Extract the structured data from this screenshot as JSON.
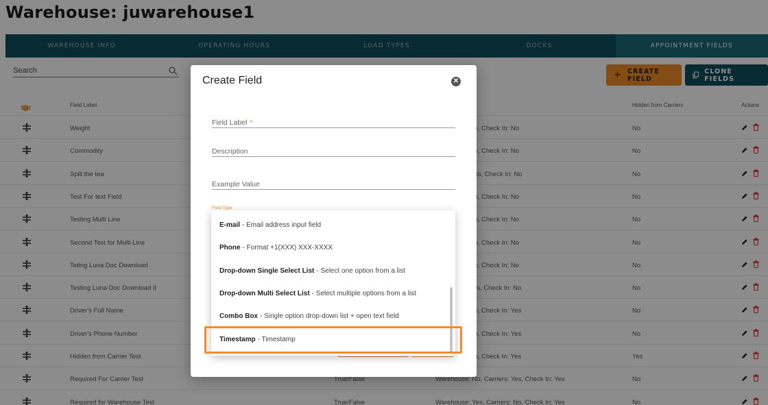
{
  "page": {
    "title": "Warehouse: juwarehouse1"
  },
  "tabs": [
    {
      "label": "WAREHOUSE INFO",
      "active": false
    },
    {
      "label": "OPERATING HOURS",
      "active": false
    },
    {
      "label": "LOAD TYPES",
      "active": false
    },
    {
      "label": "DOCKS",
      "active": false
    },
    {
      "label": "APPOINTMENT FIELDS",
      "active": true
    }
  ],
  "search": {
    "label": "Search"
  },
  "toolbar": {
    "create_label": "CREATE FIELD",
    "create_icon": "+",
    "clone_label": "CLONE FIELDS"
  },
  "table": {
    "headers": {
      "sort": "Sort",
      "field_label": "Field Label",
      "hidden": "Hidden from Carriers",
      "actions": "Actions"
    },
    "rows": [
      {
        "label": "Weight",
        "ftype": "",
        "req": "o, Carriers: No, Check In: No",
        "hidden": "No"
      },
      {
        "label": "Commodity",
        "ftype": "",
        "req": "o, Carriers: No, Check In: No",
        "hidden": "No"
      },
      {
        "label": "Spill the tea",
        "ftype": "",
        "req": "es, Carriers: No, Check In: No",
        "hidden": "No"
      },
      {
        "label": "Test For text Field",
        "ftype": "",
        "req": "o, Carriers: No, Check In: No",
        "hidden": "No"
      },
      {
        "label": "Testing Multi Line",
        "ftype": "",
        "req": "o, Carriers: No, Check In: No",
        "hidden": "No"
      },
      {
        "label": "Second Test for Multi Line",
        "ftype": "",
        "req": "o, Carriers: No, Check In: No",
        "hidden": "No"
      },
      {
        "label": "Teting Luna Doc Download",
        "ftype": "",
        "req": "o, Carriers: No, Check In: No",
        "hidden": "No"
      },
      {
        "label": "Testing Luna Doc Download II",
        "ftype": "",
        "req": "o, Carriers: Yes, Check In: No",
        "hidden": "No"
      },
      {
        "label": "Driver's Full Name",
        "ftype": "",
        "req": "o, Carriers: No, Check In: Yes",
        "hidden": "No"
      },
      {
        "label": "Driver's Phone Number",
        "ftype": "",
        "req": "o, Carriers: No, Check In: Yes",
        "hidden": "No"
      },
      {
        "label": "Hidden from Carrier Test",
        "ftype": "",
        "req": "o, Carriers: No, Check In: Yes",
        "hidden": "Yes"
      },
      {
        "label": "Required For Carrier Test",
        "ftype": "True/False",
        "req": "Warehouse: No, Carriers: Yes, Check In: Yes",
        "hidden": "No"
      },
      {
        "label": "Required for Warehouse Test",
        "ftype": "True/False",
        "req": "Warehouse: Yes, Carriers: No, Check In: Yes",
        "hidden": "No"
      }
    ]
  },
  "modal": {
    "title": "Create Field",
    "field_label": "Field Label",
    "required_star": "*",
    "description": "Description",
    "example_value": "Example Value",
    "field_type_label": "Field Type"
  },
  "dropdown": {
    "options": [
      {
        "name": "E-mail",
        "desc": "- Email address input field"
      },
      {
        "name": "Phone",
        "desc": "- Format +1(XXX) XXX-XXXX"
      },
      {
        "name": "Drop-down Single Select List",
        "desc": "- Select one option from a list"
      },
      {
        "name": "Drop-down Multi Select List",
        "desc": "- Select multiple options from a list"
      },
      {
        "name": "Combo Box",
        "desc": "- Single option drop-down list + open text field"
      },
      {
        "name": "Timestamp",
        "desc": "- Timestamp"
      }
    ],
    "highlighted": "Timestamp"
  },
  "colors": {
    "accent": "#f28c28",
    "brand": "#0e4d5e",
    "danger": "#e53935"
  }
}
